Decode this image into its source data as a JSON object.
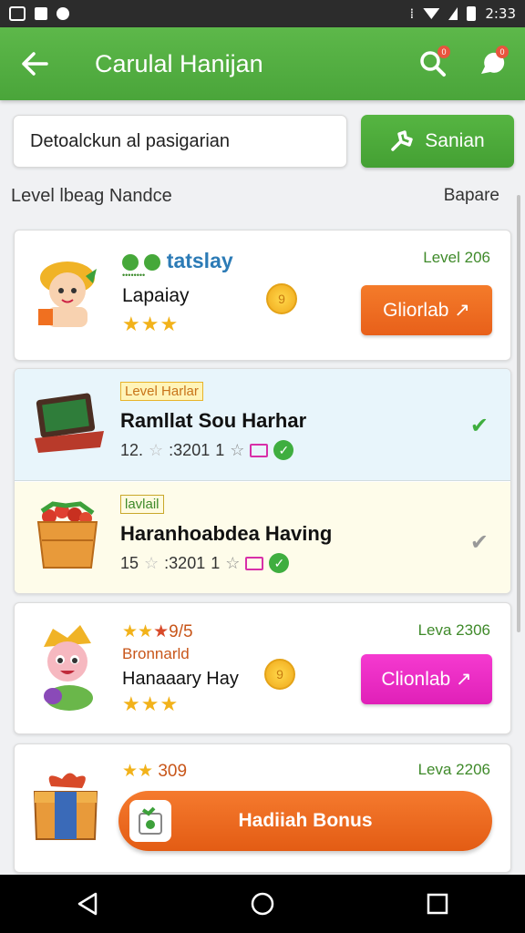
{
  "status_bar": {
    "time": "2:33"
  },
  "app_bar": {
    "title": "Carulal Hanijan",
    "search_badge": "0",
    "chat_badge": "0"
  },
  "search": {
    "value": "Detoalckun al pasigarian",
    "button_label": "Sanian"
  },
  "section": {
    "left_label": "Level lbeag Nandce",
    "right_label": "Bapare"
  },
  "cards": [
    {
      "brand": "tatslay",
      "brand_sub": "••••••••",
      "name": "Lapaiay",
      "stars": "★★★",
      "coin": "9",
      "level": "Level 206",
      "button_label": "Gliorlab ↗"
    },
    {
      "tag": "Level Harlar",
      "title": "Ramllat Sou Harhar",
      "meta_num": "12.",
      "meta_val": ":3201",
      "meta_star_num": "1"
    },
    {
      "tag": "lavlail",
      "title": "Haranhoabdea Having",
      "meta_num": "15",
      "meta_val": ":3201",
      "meta_star_num": "1"
    },
    {
      "rating": "★★",
      "rating_text": "9/5",
      "subtitle": "Bronnarld",
      "name": "Hanaaary Hay",
      "stars": "★★★",
      "coin": "9",
      "level": "Leva 2306",
      "button_label": "Clionlab ↗"
    },
    {
      "rating": "★★",
      "rating_text": "309",
      "level": "Leva 2206",
      "bonus_label": "Hadiiah Bonus"
    }
  ],
  "colors": {
    "primary_green": "#4aa53a",
    "orange": "#e8601a",
    "pink": "#e020b8",
    "blue_brand": "#2c7bb6"
  }
}
